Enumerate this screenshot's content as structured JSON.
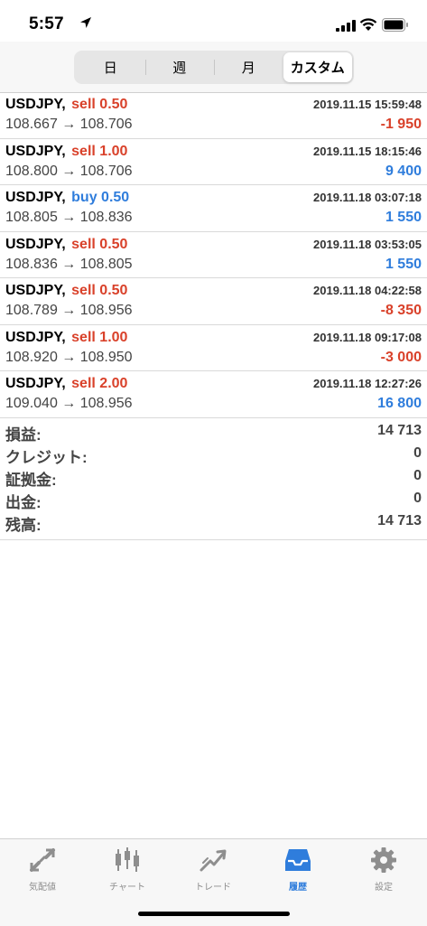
{
  "status_bar": {
    "time": "5:57"
  },
  "segments": [
    {
      "label": "日",
      "active": false
    },
    {
      "label": "週",
      "active": false
    },
    {
      "label": "月",
      "active": false
    },
    {
      "label": "カスタム",
      "active": true
    }
  ],
  "trades": [
    {
      "symbol": "USDJPY,",
      "side": "sell 0.50",
      "side_type": "sell",
      "price": "108.667 → 108.706",
      "time": "2019.11.15 15:59:48",
      "profit": "-1 950",
      "profit_sign": "neg"
    },
    {
      "symbol": "USDJPY,",
      "side": "sell 1.00",
      "side_type": "sell",
      "price": "108.800 → 108.706",
      "time": "2019.11.15 18:15:46",
      "profit": "9 400",
      "profit_sign": "pos"
    },
    {
      "symbol": "USDJPY,",
      "side": "buy 0.50",
      "side_type": "buy",
      "price": "108.805 → 108.836",
      "time": "2019.11.18 03:07:18",
      "profit": "1 550",
      "profit_sign": "pos"
    },
    {
      "symbol": "USDJPY,",
      "side": "sell 0.50",
      "side_type": "sell",
      "price": "108.836 → 108.805",
      "time": "2019.11.18 03:53:05",
      "profit": "1 550",
      "profit_sign": "pos"
    },
    {
      "symbol": "USDJPY,",
      "side": "sell 0.50",
      "side_type": "sell",
      "price": "108.789 → 108.956",
      "time": "2019.11.18 04:22:58",
      "profit": "-8 350",
      "profit_sign": "neg"
    },
    {
      "symbol": "USDJPY,",
      "side": "sell 1.00",
      "side_type": "sell",
      "price": "108.920 → 108.950",
      "time": "2019.11.18 09:17:08",
      "profit": "-3 000",
      "profit_sign": "neg"
    },
    {
      "symbol": "USDJPY,",
      "side": "sell 2.00",
      "side_type": "sell",
      "price": "109.040 → 108.956",
      "time": "2019.11.18 12:27:26",
      "profit": "16 800",
      "profit_sign": "pos"
    }
  ],
  "summary": [
    {
      "label": "損益:",
      "value": "14 713"
    },
    {
      "label": "クレジット:",
      "value": "0"
    },
    {
      "label": "証拠金:",
      "value": "0"
    },
    {
      "label": "出金:",
      "value": "0"
    },
    {
      "label": "残高:",
      "value": "14 713"
    }
  ],
  "tabs": [
    {
      "label": "気配値",
      "icon": "quotes-icon",
      "active": false
    },
    {
      "label": "チャート",
      "icon": "chart-candles-icon",
      "active": false
    },
    {
      "label": "トレード",
      "icon": "trade-icon",
      "active": false
    },
    {
      "label": "履歴",
      "icon": "history-inbox-icon",
      "active": true
    },
    {
      "label": "設定",
      "icon": "gear-icon",
      "active": false
    }
  ],
  "colors": {
    "sell": "#d9412a",
    "buy": "#2f7ddc",
    "loss": "#d9412a",
    "profit": "#2f7ddc",
    "tab_active": "#2f7ddc",
    "tab_inactive": "#8e8e8e"
  }
}
